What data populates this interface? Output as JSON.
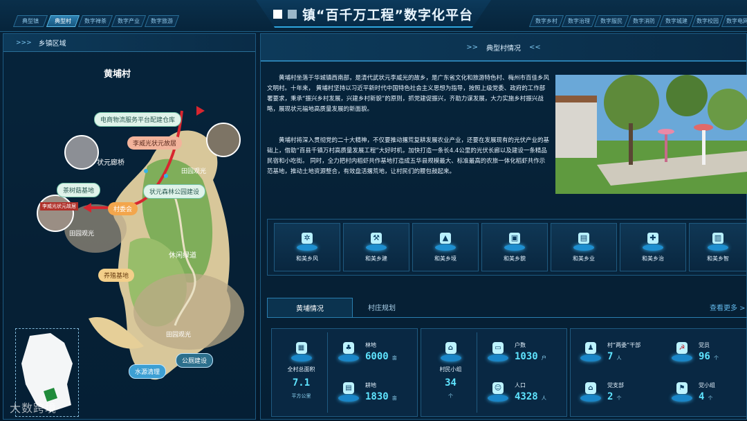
{
  "header": {
    "title": "镇“百千万工程”数字化平台",
    "left_tabs": [
      "典型镇",
      "典型村",
      "数字禅茶",
      "数字产业",
      "数字旅游"
    ],
    "right_tabs": [
      "数字乡村",
      "数字治理",
      "数字服民",
      "数字消防",
      "数字城建",
      "数字校园",
      "数字电网"
    ],
    "active_tab": "典型村"
  },
  "left_panel": {
    "section_title": "乡镇区域",
    "village_name": "黄埔村",
    "map_labels": {
      "ecommerce": "电商物流服务平台配建仓库",
      "former_residence": "李威光状元故居",
      "bridge": "状元廊桥",
      "field1": "田园观光",
      "forest": "状元森林公园建设",
      "mushroom": "茶树菇基地",
      "committee": "村委会",
      "field2": "田园观光",
      "greenway": "休闲绿道",
      "breeding": "养殖基地",
      "field3": "田园观光",
      "water": "水源清理",
      "toilet": "公厕建设"
    },
    "photo_caption": "李威光状元故居"
  },
  "right_panel": {
    "section_title": "典型村情况",
    "paragraph1": "黄埔村坐落于华城镇西南部，是清代武状元李威光的故乡，是广东省文化和旅游特色村、梅州市百佳乡风文明村。十年来， 黄埔村坚持以习近平新时代中国特色社会主义思想为指导，按照上级党委、政府的工作部署要求，秉承“振兴乡村发展，兴建乡村新貌”的原则，抓党建促振兴，齐助力谋发展，大力实施乡村振兴战略，展现状元福地高质量发展的新面貌。",
    "paragraph2": "黄埔村将深入贯彻党的二十大精神，不仅要推动撂荒复耕发展农业产业，还要在发展现有的光伏产业的基础上，借助“百县千镇万村高质量发展工程”大好时机，加快打造一条长4.4公里的光伏长廊以及建设一条精品民宿和小吃街。 同时，全力把村内稻虾共作基地打造成五华县规模最大、标准最高的农旅一体化稻虾共作示范基地，推动土地资源整合，有效盘活撂荒地，让村民们的腰包鼓起来。",
    "categories": [
      {
        "label": "和美乡风",
        "icon": "wind-icon",
        "glyph": "✲"
      },
      {
        "label": "和美乡建",
        "icon": "build-icon",
        "glyph": "⚒"
      },
      {
        "label": "和美乡境",
        "icon": "mountain-icon",
        "glyph": "▲"
      },
      {
        "label": "和美乡貌",
        "icon": "landscape-icon",
        "glyph": "▣"
      },
      {
        "label": "和美乡业",
        "icon": "briefcase-icon",
        "glyph": "▤"
      },
      {
        "label": "和美乡治",
        "icon": "compass-icon",
        "glyph": "✚"
      },
      {
        "label": "和美乡智",
        "icon": "book-icon",
        "glyph": "▥"
      }
    ],
    "tabs": [
      "黄埔情况",
      "村庄规划"
    ],
    "active_tab": "黄埔情况",
    "see_more": "查看更多 >",
    "stats": {
      "total_area": {
        "label": "全村总面积",
        "value": "7.1",
        "unit": "平方公里"
      },
      "forest": {
        "label": "林地",
        "value": "6000",
        "unit": "亩"
      },
      "arable": {
        "label": "耕地",
        "value": "1830",
        "unit": "亩"
      },
      "groups": {
        "label": "村民小组",
        "value": "34",
        "unit": "个"
      },
      "households": {
        "label": "户数",
        "value": "1030",
        "unit": "户"
      },
      "population": {
        "label": "人口",
        "value": "4328",
        "unit": "人"
      },
      "cadres": {
        "label": "村“两委”干部",
        "value": "7",
        "unit": "人"
      },
      "party_members": {
        "label": "党员",
        "value": "96",
        "unit": "个"
      },
      "party_branch": {
        "label": "党支部",
        "value": "2",
        "unit": "个"
      },
      "party_groups": {
        "label": "党小组",
        "value": "4",
        "unit": "个"
      }
    }
  },
  "watermark": "大数跨境",
  "colors": {
    "accent": "#2ea7e0",
    "value": "#5fe4ff",
    "route": "#e0303a"
  }
}
